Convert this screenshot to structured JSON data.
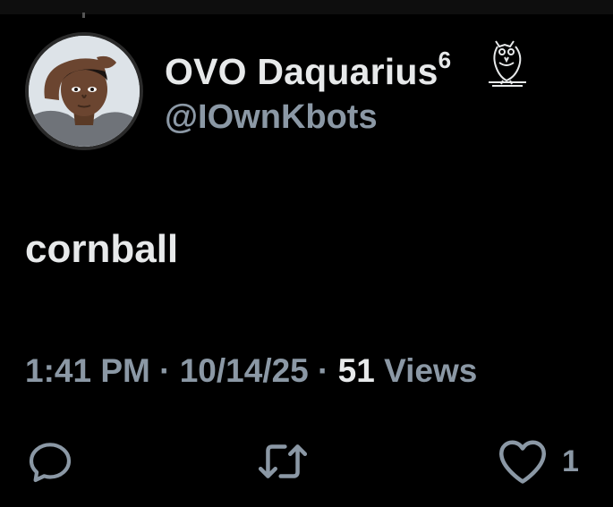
{
  "user": {
    "display_name": "OVO Daquarius",
    "name_superscript": "6",
    "handle": "@IOwnKbots",
    "badge_icon": "owl-icon"
  },
  "tweet": {
    "text": "cornball"
  },
  "meta": {
    "time": "1:41 PM",
    "separator": "·",
    "date": "10/14/25",
    "views_count": "51",
    "views_label": "Views"
  },
  "actions": {
    "reply_icon": "reply-icon",
    "retweet_icon": "retweet-icon",
    "like_icon": "heart-icon",
    "like_count": "1"
  },
  "colors": {
    "background": "#000000",
    "primary_text": "#e7e9ea",
    "secondary_text": "#8b98a5"
  }
}
